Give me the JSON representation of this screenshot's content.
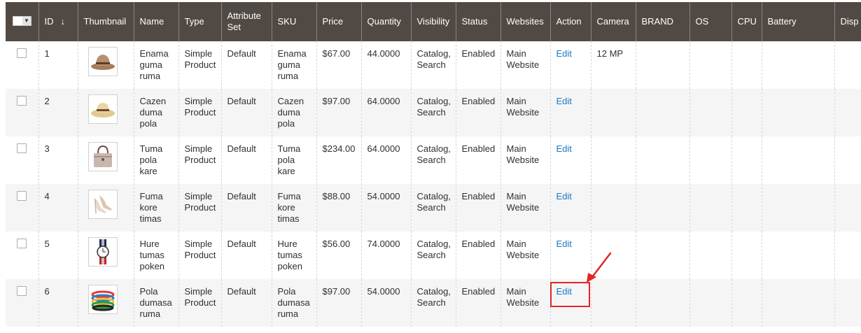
{
  "columns": {
    "id": "ID",
    "id_sort": "↓",
    "thumbnail": "Thumbnail",
    "name": "Name",
    "type": "Type",
    "attribute_set": "Attribute Set",
    "sku": "SKU",
    "price": "Price",
    "quantity": "Quantity",
    "visibility": "Visibility",
    "status": "Status",
    "websites": "Websites",
    "action": "Action",
    "camera": "Camera",
    "brand": "BRAND",
    "os": "OS",
    "cpu": "CPU",
    "battery": "Battery",
    "display": "Disp"
  },
  "rows": [
    {
      "id": "1",
      "name": "Enama guma ruma",
      "type": "Simple Product",
      "attribute_set": "Default",
      "sku": "Enama guma ruma",
      "price": "$67.00",
      "quantity": "44.0000",
      "visibility": "Catalog, Search",
      "status": "Enabled",
      "websites": "Main Website",
      "action": "Edit",
      "camera": "12 MP",
      "thumb_icon": "fedora-hat-icon"
    },
    {
      "id": "2",
      "name": "Cazen duma pola",
      "type": "Simple Product",
      "attribute_set": "Default",
      "sku": "Cazen duma pola",
      "price": "$97.00",
      "quantity": "64.0000",
      "visibility": "Catalog, Search",
      "status": "Enabled",
      "websites": "Main Website",
      "action": "Edit",
      "camera": "",
      "thumb_icon": "straw-hat-icon"
    },
    {
      "id": "3",
      "name": "Tuma pola kare",
      "type": "Simple Product",
      "attribute_set": "Default",
      "sku": "Tuma pola kare",
      "price": "$234.00",
      "quantity": "64.0000",
      "visibility": "Catalog, Search",
      "status": "Enabled",
      "websites": "Main Website",
      "action": "Edit",
      "camera": "",
      "thumb_icon": "handbag-icon"
    },
    {
      "id": "4",
      "name": "Fuma kore timas",
      "type": "Simple Product",
      "attribute_set": "Default",
      "sku": "Fuma kore timas",
      "price": "$88.00",
      "quantity": "54.0000",
      "visibility": "Catalog, Search",
      "status": "Enabled",
      "websites": "Main Website",
      "action": "Edit",
      "camera": "",
      "thumb_icon": "heels-icon"
    },
    {
      "id": "5",
      "name": "Hure tumas poken",
      "type": "Simple Product",
      "attribute_set": "Default",
      "sku": "Hure tumas poken",
      "price": "$56.00",
      "quantity": "74.0000",
      "visibility": "Catalog, Search",
      "status": "Enabled",
      "websites": "Main Website",
      "action": "Edit",
      "camera": "",
      "thumb_icon": "watch-icon"
    },
    {
      "id": "6",
      "name": "Pola dumasa ruma",
      "type": "Simple Product",
      "attribute_set": "Default",
      "sku": "Pola dumasa ruma",
      "price": "$97.00",
      "quantity": "54.0000",
      "visibility": "Catalog, Search",
      "status": "Enabled",
      "websites": "Main Website",
      "action": "Edit",
      "camera": "",
      "thumb_icon": "bracelets-icon"
    }
  ],
  "colors": {
    "header_bg": "#514943",
    "link": "#1979c3",
    "highlight": "#e22626",
    "row_alt": "#f5f5f5"
  }
}
